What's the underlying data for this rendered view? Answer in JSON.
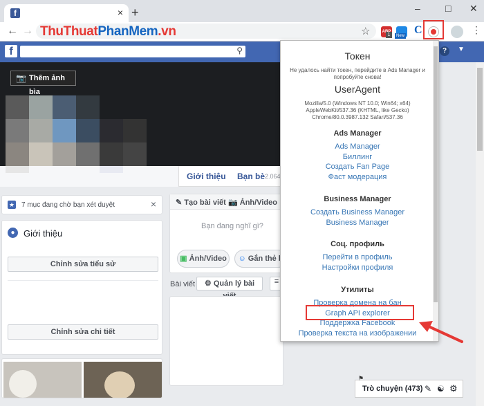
{
  "browser": {
    "tab_close": "×",
    "new_tab": "+",
    "win_min": "–",
    "win_max": "□",
    "win_close": "✕",
    "watermark_part1": "ThuThuat",
    "watermark_part2": "PhanMem",
    "watermark_part3": ".vn",
    "ext_badge_abp": "ABP",
    "ext_badge_count": "1",
    "ext_badge_new": "New"
  },
  "profile": {
    "cover_button": "Thêm ảnh bìa",
    "tab_intro": "Giới thiệu",
    "tab_friends": "Bạn bè",
    "friends_count": "2.064",
    "pending_notice": "7 mục đang chờ bạn xét duyệt",
    "pending_close": "×",
    "intro_title": "Giới thiệu",
    "edit_bio": "Chỉnh sửa tiểu sử",
    "edit_details": "Chỉnh sửa chi tiết",
    "create_post": "Tạo bài viết",
    "photo_video_tab": "Ảnh/Video",
    "post_placeholder": "Bạn đang nghĩ gì?",
    "photo_video_btn": "Ảnh/Video",
    "tag_friends_btn": "Gắn thẻ b",
    "posts_label": "Bài viết",
    "manage_posts": "Quản lý bài viết",
    "chat_label": "Trò chuyện (473)"
  },
  "popup": {
    "token_title": "Токен",
    "token_error": "Не удалось найти токен, перейдите в Ads Manager и попробуйте снова!",
    "ua_title": "UserAgent",
    "ua_line1": "Mozilla/5.0 (Windows NT 10.0; Win64; x64)",
    "ua_line2": "AppleWebKit/537.36 (KHTML, like Gecko)",
    "ua_line3": "Chrome/80.0.3987.132 Safari/537.36",
    "sections": [
      {
        "title": "Ads Manager",
        "links": [
          "Ads Manager",
          "Биллинг",
          "Создать Fan Page",
          "Фаст модерация"
        ]
      },
      {
        "title": "Business Manager",
        "links": [
          "Создать Business Manager",
          "Business Manager"
        ]
      },
      {
        "title": "Соц. профиль",
        "links": [
          "Перейти в профиль",
          "Настройки профиля"
        ]
      },
      {
        "title": "Утилиты",
        "links": [
          "Проверка домена на бан",
          "Graph API explorer",
          "Поддержка Facebook",
          "Проверка текста на изображении"
        ]
      }
    ]
  },
  "colors": {
    "fb_blue": "#4267b2",
    "link": "#3776b5",
    "highlight_red": "#e53935"
  }
}
